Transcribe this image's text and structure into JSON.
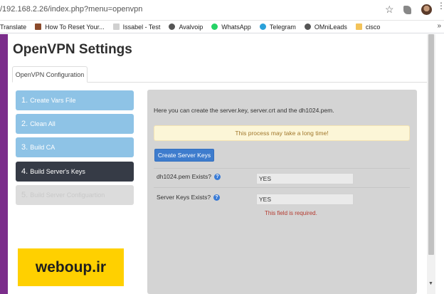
{
  "browser": {
    "url": "/192.168.2.26/index.php?menu=openvpn",
    "bookmarks": [
      {
        "label": "Translate",
        "icon": "none",
        "color": "#ffffff"
      },
      {
        "label": "How To Reset Your...",
        "icon": "site-icon",
        "color": "#8b4a2b"
      },
      {
        "label": "Issabel - Test",
        "icon": "grid-icon",
        "color": "#b8b8b8"
      },
      {
        "label": "Avalvoip",
        "icon": "globe-icon",
        "color": "#555555"
      },
      {
        "label": "WhatsApp",
        "icon": "whatsapp-icon",
        "color": "#25d366"
      },
      {
        "label": "Telegram",
        "icon": "telegram-icon",
        "color": "#2aa1da"
      },
      {
        "label": "OMniLeads",
        "icon": "globe-icon",
        "color": "#555555"
      },
      {
        "label": "cisco",
        "icon": "folder-icon",
        "color": "#f3c35a"
      }
    ],
    "more": "»"
  },
  "page": {
    "title": "OpenVPN Settings",
    "tab": "OpenVPN Configuration"
  },
  "steps": [
    {
      "num": "1.",
      "label": "Create Vars File",
      "state": "done"
    },
    {
      "num": "2.",
      "label": "Clean All",
      "state": "done"
    },
    {
      "num": "3.",
      "label": "Build CA",
      "state": "done"
    },
    {
      "num": "4.",
      "label": "Build Server's Keys",
      "state": "active"
    },
    {
      "num": "5.",
      "label": "Build Server Configuartion",
      "state": "disabled"
    }
  ],
  "panel": {
    "intro": "Here you can create the server.key, server.crt and the dh1024.pem.",
    "warning": "This process may take a long time!",
    "button": "Create Server Keys",
    "fields": [
      {
        "label": "dh1024.pem Exists?",
        "value": "YES"
      },
      {
        "label": "Server Keys Exists?",
        "value": "YES"
      }
    ],
    "error": "This field is required."
  },
  "watermark": "weboup.ir",
  "colors": {
    "accent_purple": "#7b2d8b",
    "step_blue": "#8ec3e6",
    "step_active": "#363b46",
    "button_blue": "#3e7ccd",
    "warning_bg": "#fcf6d7",
    "error_red": "#b43a2f"
  }
}
